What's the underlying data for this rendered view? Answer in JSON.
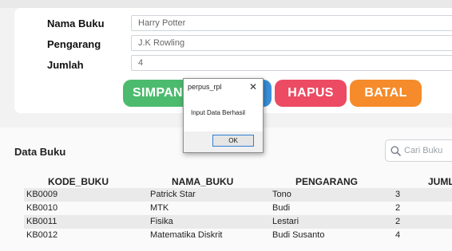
{
  "form": {
    "nama_buku_label": "Nama Buku",
    "nama_buku_value": "Harry Potter",
    "pengarang_label": "Pengarang",
    "pengarang_value": "J.K Rowling",
    "jumlah_label": "Jumlah",
    "jumlah_value": "4"
  },
  "buttons": {
    "simpan": "SIMPAN",
    "hapus": "HAPUS",
    "batal": "BATAL"
  },
  "colors": {
    "simpan": "#4cbb6e",
    "update": "#3b8fd8",
    "hapus": "#ec4b63",
    "batal": "#f58b2a"
  },
  "section": {
    "title": "Data Buku",
    "search_placeholder": "Cari Buku",
    "search_icon": "search-icon"
  },
  "table": {
    "headers": [
      "KODE_BUKU",
      "NAMA_BUKU",
      "PENGARANG",
      "JUMLAH"
    ],
    "rows": [
      [
        "KB0009",
        "Patrick Star",
        "Tono",
        "3"
      ],
      [
        "KB0010",
        "MTK",
        "Budi",
        "2"
      ],
      [
        "KB0011",
        "Fisika",
        "Lestari",
        "2"
      ],
      [
        "KB0012",
        "Matematika Diskrit",
        "Budi Susanto",
        "4"
      ]
    ]
  },
  "dialog": {
    "title": "perpus_rpl",
    "close": "✕",
    "message": "Input Data Berhasil",
    "ok": "OK"
  }
}
